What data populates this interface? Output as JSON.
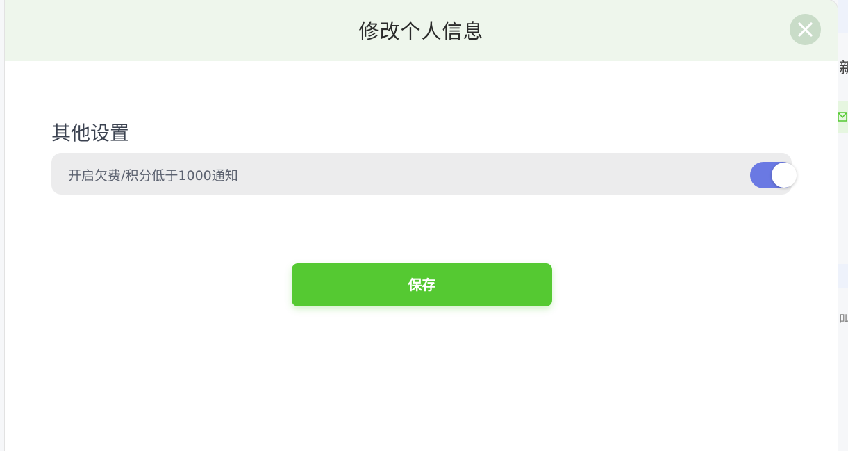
{
  "background": {
    "fragment_top": "新",
    "fragment_mail_icon": "mail-icon",
    "fragment_bottom": "叫"
  },
  "modal": {
    "title": "修改个人信息",
    "close_icon": "close-icon"
  },
  "settings": {
    "section_title": "其他设置",
    "items": [
      {
        "label": "开启欠费/积分低于1000通知",
        "enabled": true
      }
    ]
  },
  "actions": {
    "save_label": "保存"
  },
  "colors": {
    "header_bg": "#eef6ec",
    "close_bg": "#c9dcc8",
    "toggle_on": "#6a79e3",
    "save_button": "#55c932"
  }
}
